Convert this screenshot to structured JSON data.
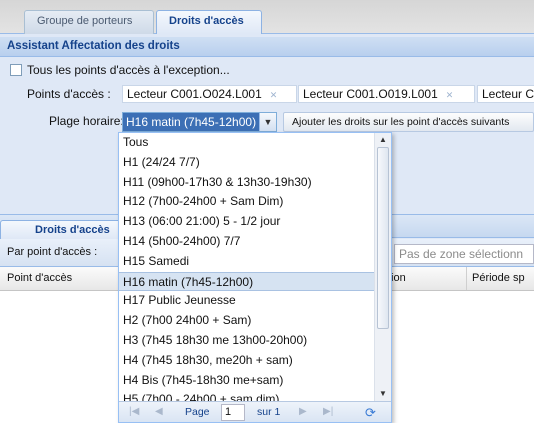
{
  "tabs": [
    "Groupe de porteurs",
    "Droits d'accès"
  ],
  "panel_title": "Assistant Affectation des droits",
  "all_points_label": "Tous les points d'accès à l'exception...",
  "access_points_label": "Points d'accès :",
  "access_points": [
    "Lecteur C001.O024.L001",
    "Lecteur C001.O019.L001",
    "Lecteur C"
  ],
  "schedule_label": "Plage horaire:",
  "schedule_value": "H16 matin (7h45-12h00)",
  "add_rights_button": "Ajouter les droits sur les point d'accès suivants",
  "section2_tab": "Droits d'accès",
  "by_point_label": "Par point d'accès :",
  "zone_placeholder": "Pas de zone sélectionn",
  "grid_columns": [
    "Point d'accès",
    "tion",
    "Période sp"
  ],
  "dropdown_items": [
    "Tous",
    "H1 (24/24 7/7)",
    "H11 (09h00-17h30 & 13h30-19h30)",
    "H12 (7h00-24h00 + Sam Dim)",
    "H13 (06:00 21:00) 5 - 1/2 jour",
    "H14 (5h00-24h00) 7/7",
    "H15 Samedi",
    "H16 matin (7h45-12h00)",
    "H17 Public Jeunesse",
    "H2 (7h00 24h00 + Sam)",
    "H3 (7h45 18h30 me 13h00-20h00)",
    "H4 (7h45 18h30, me20h + sam)",
    "H4 Bis (7h45-18h30 me+sam)",
    "H5 (7h00 - 24h00 + sam dim)"
  ],
  "selected_index": 7,
  "pager": {
    "page_label": "Page",
    "page_value": "1",
    "of_label": "sur 1"
  },
  "colors": {
    "selection": "#3c6fb5",
    "header_text": "#15428b",
    "panel_bg": "#dfe8f6"
  }
}
